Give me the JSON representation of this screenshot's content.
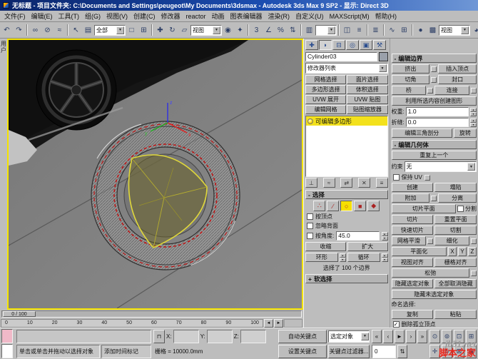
{
  "window": {
    "title": "无标题 - 项目文件夹: C:\\Documents and Settings\\peugeot\\My Documents\\3dsmax - Autodesk 3ds Max 9 SP2 - 显示: Direct 3D"
  },
  "menu": {
    "items": [
      "文件(F)",
      "编辑(E)",
      "工具(T)",
      "组(G)",
      "视图(V)",
      "创建(C)",
      "修改器",
      "reactor",
      "动画",
      "图表编辑器",
      "渲染(R)",
      "自定义(U)",
      "MAXScript(M)",
      "帮助(H)"
    ]
  },
  "toolbar": {
    "selection_filter": "全部",
    "reference_coord": "视图",
    "render_type": "视图"
  },
  "viewport": {
    "label": "用户",
    "axis_x": "x",
    "axis_y": "y",
    "axis_z": "z"
  },
  "panel": {
    "object_name": "Cylinder03",
    "modifier_list": "修改器列表",
    "modifier_buttons": [
      "网格选择",
      "面片选择",
      "多边形选择",
      "体积选择",
      "UVW 展开",
      "UVW 贴图",
      "编辑网格",
      "贴图缩放器"
    ],
    "stack_item": "可编辑多边形",
    "selection": {
      "title": "选择",
      "by_vertex": "按顶点",
      "ignore_backfacing": "忽略背面",
      "by_angle": "按角度:",
      "angle": "45.0",
      "shrink": "收缩",
      "grow": "扩大",
      "ring": "环形",
      "loop": "循环",
      "info": "选择了 100 个边界"
    },
    "soft_selection": {
      "title": "软选择"
    },
    "edit_borders": {
      "title": "编辑边界",
      "extrude": "挤出",
      "insert_vertex": "插入顶点",
      "chamfer": "切角",
      "cap": "封口",
      "bridge": "桥",
      "connect": "连接",
      "create_shape": "利用所选内容创建图形",
      "weight": "权重:",
      "weight_val": "1.0",
      "crease": "折缝:",
      "crease_val": "0.0",
      "edit_tri": "编辑三角剖分",
      "turn": "旋转"
    },
    "edit_geometry": {
      "title": "编辑几何体",
      "repeat_last": "重复上一个",
      "constraints": "约束",
      "constraints_val": "无",
      "preserve_uvs": "保持 UV",
      "create": "创建",
      "collapse": "塌陷",
      "attach": "附加",
      "detach": "分离",
      "slice_plane": "切片平面",
      "split": "分割",
      "slice": "切片",
      "reset_plane": "重置平面",
      "quickslice": "快速切片",
      "cut": "切割",
      "msmooth": "网格平滑",
      "tessellate": "细化",
      "make_planar": "平面化",
      "x": "X",
      "y": "Y",
      "z": "Z",
      "view_align": "视图对齐",
      "grid_align": "栅格对齐",
      "relax": "松弛",
      "hide_selected": "隐藏选定对象",
      "unhide_all": "全部取消隐藏",
      "hide_unselected": "隐藏未选定对象",
      "named_sel": "命名选择:",
      "copy": "复制",
      "paste": "粘贴",
      "delete_isolated": "删除孤立顶点"
    }
  },
  "timeline": {
    "slider": "0 / 100"
  },
  "trackbar": {
    "ticks": [
      "0",
      "10",
      "20",
      "30",
      "40",
      "50",
      "60",
      "70",
      "80",
      "90",
      "100"
    ]
  },
  "status": {
    "prompt": "单击或单击并拖动以选择对象",
    "time_tag": "添加时间标记",
    "grid": "栅格 = 10000.0mm",
    "x": "X:",
    "y": "Y:",
    "z": "Z:",
    "auto_key": "自动关键点",
    "set_key": "设置关键点",
    "selection_set": "选定对象",
    "key_filters": "关键点过滤器...",
    "frame": "0"
  },
  "watermark": {
    "site": "jb51.net",
    "name": "脚本之家"
  },
  "colors": {
    "viewport_border": "#f5e400",
    "selected_border_red": "#c01010",
    "wireframe_yellow": "#e0d83a",
    "stack_highlight": "#f3e11c"
  },
  "icons": {
    "undo": "↶",
    "redo": "↷",
    "link": "∞",
    "unlink": "⊘",
    "bind": "≈",
    "select": "↖",
    "select_by_name": "▤",
    "region": "□",
    "window_crossing": "⊞",
    "move": "✚",
    "rotate": "↻",
    "scale": "▱",
    "pivot": "◉",
    "manipulate": "✦",
    "snap": "3",
    "angle_snap": "∠",
    "percent_snap": "%",
    "spinner_snap": "⇅",
    "named_sets": "▥",
    "mirror": "◫",
    "align": "≡",
    "layers": "≣",
    "curve_editor": "∿",
    "schematic": "⊞",
    "material": "●",
    "render": "▩",
    "quick_render": "◕",
    "dropdown": "▼",
    "spin_up": "▴",
    "spin_down": "▾",
    "tab_create": "✚",
    "tab_modify": "◗",
    "tab_hierarchy": "⊟",
    "tab_motion": "◎",
    "tab_display": "▣",
    "tab_utilities": "⚒",
    "pin": "⊥",
    "show_end": "≈",
    "make_unique": "⇄",
    "remove": "✕",
    "configure": "≡",
    "so_vertex": "∴",
    "so_edge": "∕",
    "so_border": "○",
    "so_polygon": "■",
    "so_element": "◆",
    "check": "✓",
    "minus": "-",
    "plus": "+",
    "play_start": "«",
    "play_prev": "‹",
    "play": "►",
    "play_next": "›",
    "play_end": "»",
    "nav_zoom": "⊙",
    "nav_zoom_all": "⊚",
    "nav_extents": "⊡",
    "nav_extents_all": "⊞",
    "nav_pan": "✛",
    "nav_arc": "↻",
    "nav_region": "⊠",
    "nav_max": "▣",
    "lock": "⊓",
    "arrow_left": "◄",
    "arrow_right": "►"
  }
}
